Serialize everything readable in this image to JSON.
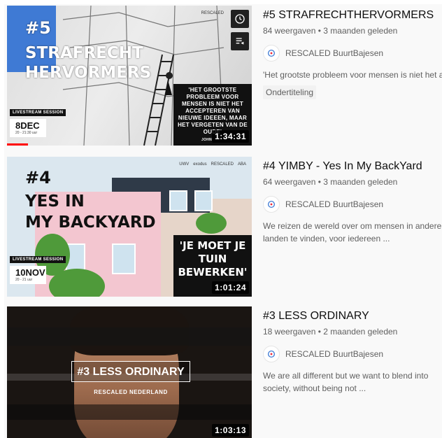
{
  "videos": [
    {
      "title": "#5 STRAFRECHTHERVORMERS",
      "views": "84 weergaven",
      "age": "3 maanden geleden",
      "channel": "RESCALED BuurtBajesen",
      "description": "'Het grootste probleem voor mensen is niet het accepteren van nieuwe ideeën' - John Maynard ...",
      "badge": "Ondertiteling",
      "duration": "1:34:31",
      "thumb": {
        "number": "#5",
        "line1": "STRAFRECHT",
        "line2": "HERVORMERS",
        "quote": "'HET GROOTSTE PROBLEEM VOOR MENSEN IS NIET HET ACCEPTEREN VAN NIEUWE IDEEEN, MAAR HET VERGETEN VAN DE OUDE'",
        "quote_author": "JOHN",
        "session": "LIVESTREAM SESSION",
        "date_day": "8",
        "date_month": "DEC",
        "date_time": "20 - 21:30 uur",
        "logo": "RESCALED"
      },
      "hover_buttons": [
        "clock-icon",
        "add-to-queue-icon"
      ]
    },
    {
      "title": "#4 YIMBY - Yes In My BackYard",
      "views": "64 weergaven",
      "age": "3 maanden geleden",
      "channel": "RESCALED BuurtBajesen",
      "description": "We reizen de wereld over om mensen in andere landen te vinden, voor iedereen ...",
      "duration": "1:01:24",
      "thumb": {
        "number": "#4",
        "line1": "YES IN",
        "line2": "MY BACKYARD",
        "quote": "'JE MOET JE TUIN BEWERKEN'",
        "session": "LIVESTREAM SESSION",
        "date_day": "10",
        "date_month": "NOV",
        "date_time": "20 - 21 uur",
        "logos": [
          "UWV",
          "exodus",
          "RESCALED",
          "ABA"
        ]
      }
    },
    {
      "title": "#3 LESS ORDINARY",
      "views": "18 weergaven",
      "age": "2 maanden geleden",
      "channel": "RESCALED BuurtBajesen",
      "description": "We are all different but we want to blend into society, without being not ...",
      "duration": "1:03:13",
      "thumb": {
        "title": "#3 LESS ORDINARY",
        "subtitle": "RESCALED NEDERLAND"
      }
    }
  ],
  "colors": {
    "accent_blue": "#3f7ad4",
    "progress_red": "#ff0000",
    "text_primary": "#0f0f0f",
    "text_secondary": "#606060"
  }
}
